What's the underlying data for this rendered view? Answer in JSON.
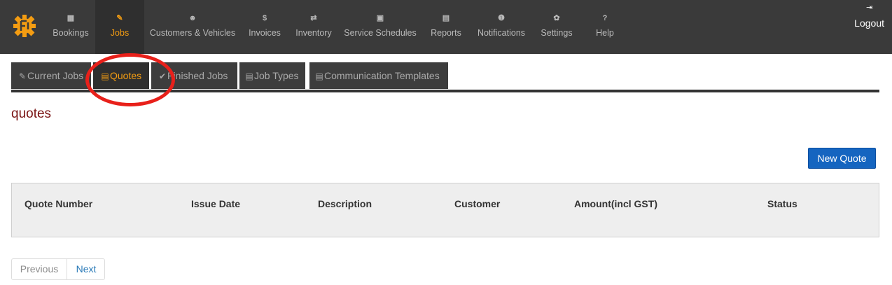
{
  "nav": {
    "items": [
      {
        "label": "Bookings",
        "icon": "calendar-icon",
        "glyph": "▦"
      },
      {
        "label": "Jobs",
        "icon": "wrench-icon",
        "glyph": "✎"
      },
      {
        "label": "Customers & Vehicles",
        "icon": "users-icon",
        "glyph": "☻"
      },
      {
        "label": "Invoices",
        "icon": "dollar-icon",
        "glyph": "$"
      },
      {
        "label": "Inventory",
        "icon": "exchange-icon",
        "glyph": "⇄"
      },
      {
        "label": "Service Schedules",
        "icon": "calendar-icon",
        "glyph": "▣"
      },
      {
        "label": "Reports",
        "icon": "chart-icon",
        "glyph": "▤"
      },
      {
        "label": "Notifications",
        "icon": "info-icon",
        "glyph": "❶"
      },
      {
        "label": "Settings",
        "icon": "gears-icon",
        "glyph": "✿"
      },
      {
        "label": "Help",
        "icon": "question-icon",
        "glyph": "?"
      }
    ],
    "active": "Jobs",
    "logout": {
      "label": "Logout",
      "icon": "sign-out-icon",
      "glyph": "⇥"
    }
  },
  "tabs": [
    {
      "label": "Current Jobs",
      "icon": "wrench-icon",
      "glyph": "✎"
    },
    {
      "label": "Quotes",
      "icon": "file-icon",
      "glyph": "▤"
    },
    {
      "label": "Finished Jobs",
      "icon": "check-icon",
      "glyph": "✔"
    },
    {
      "label": "Job Types",
      "icon": "file-icon",
      "glyph": "▤"
    },
    {
      "label": "Communication Templates",
      "icon": "file-icon",
      "glyph": "▤"
    }
  ],
  "active_tab": "Quotes",
  "page": {
    "title": "quotes"
  },
  "toolbar": {
    "new_quote_label": "New Quote"
  },
  "table": {
    "columns": [
      "Quote Number",
      "Issue Date",
      "Description",
      "Customer",
      "Amount(incl GST)",
      "Status"
    ],
    "rows": []
  },
  "pagination": {
    "previous_label": "Previous",
    "next_label": "Next"
  },
  "colors": {
    "nav_bg": "#3a3a3a",
    "accent": "#f39c12",
    "title": "#7a1414",
    "primary_button": "#1565c0",
    "annotation": "#e8201a"
  }
}
